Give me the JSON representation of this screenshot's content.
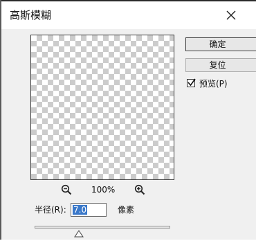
{
  "dialog": {
    "title": "高斯模糊",
    "close_icon": "close-icon"
  },
  "buttons": {
    "ok_label": "确定",
    "reset_label": "复位"
  },
  "preview_option": {
    "label": "预览(P)",
    "checked": true
  },
  "zoom": {
    "level": "100%",
    "zoom_out_icon": "zoom-out-icon",
    "zoom_in_icon": "zoom-in-icon"
  },
  "radius": {
    "label": "半径(R):",
    "value": "7.0",
    "unit": "像素"
  },
  "slider": {
    "thumb_icon": "slider-thumb-icon"
  },
  "colors": {
    "dialog_bg": "#f0f0f0",
    "selection": "#3a78c9"
  }
}
